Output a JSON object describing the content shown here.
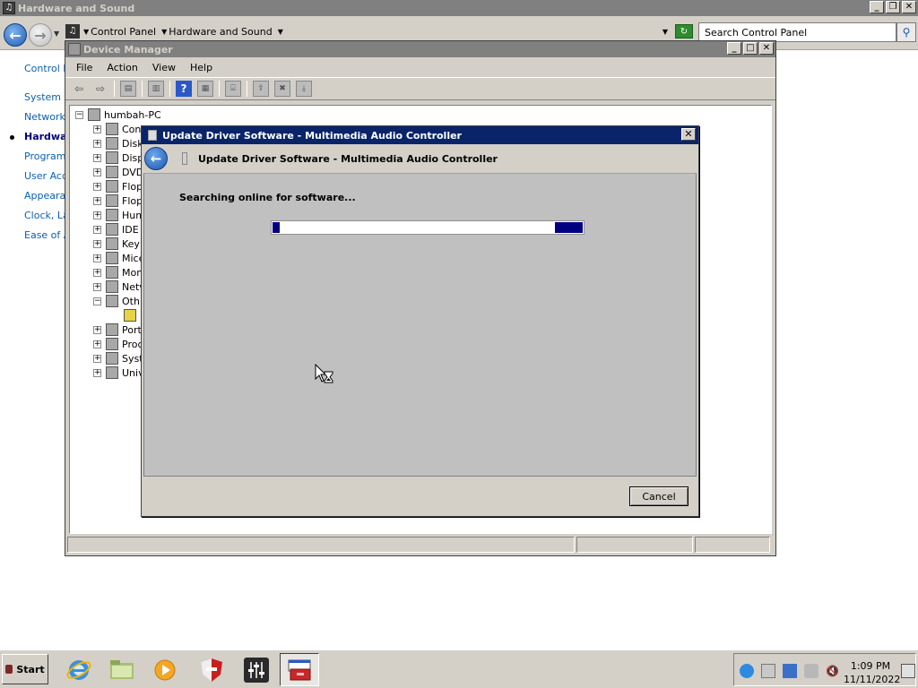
{
  "control_panel": {
    "title": "Hardware and Sound",
    "breadcrumb": [
      "Control Panel",
      "Hardware and Sound"
    ],
    "search_placeholder": "Search Control Panel",
    "nav": [
      "Control P",
      "System a",
      "Network",
      "Hardwa",
      "Programs",
      "User Acco",
      "Appearan",
      "Clock, La",
      "Ease of A"
    ]
  },
  "device_manager": {
    "title": "Device Manager",
    "menu": [
      "File",
      "Action",
      "View",
      "Help"
    ],
    "root": "humbah-PC",
    "tree": [
      "Con",
      "Disk",
      "Disp",
      "DVD",
      "Flop",
      "Flop",
      "Hum",
      "IDE",
      "Key",
      "Mice",
      "Mon",
      "Netv",
      "Oth",
      "",
      "Port",
      "Proc",
      "Syst",
      "Univ"
    ]
  },
  "dialog": {
    "title": "Update Driver Software - Multimedia Audio Controller",
    "header": "Update Driver Software - Multimedia Audio Controller",
    "status": "Searching online for software...",
    "cancel_label": "Cancel"
  },
  "taskbar": {
    "start_label": "Start",
    "time": "1:09 PM",
    "date": "11/11/2022"
  }
}
